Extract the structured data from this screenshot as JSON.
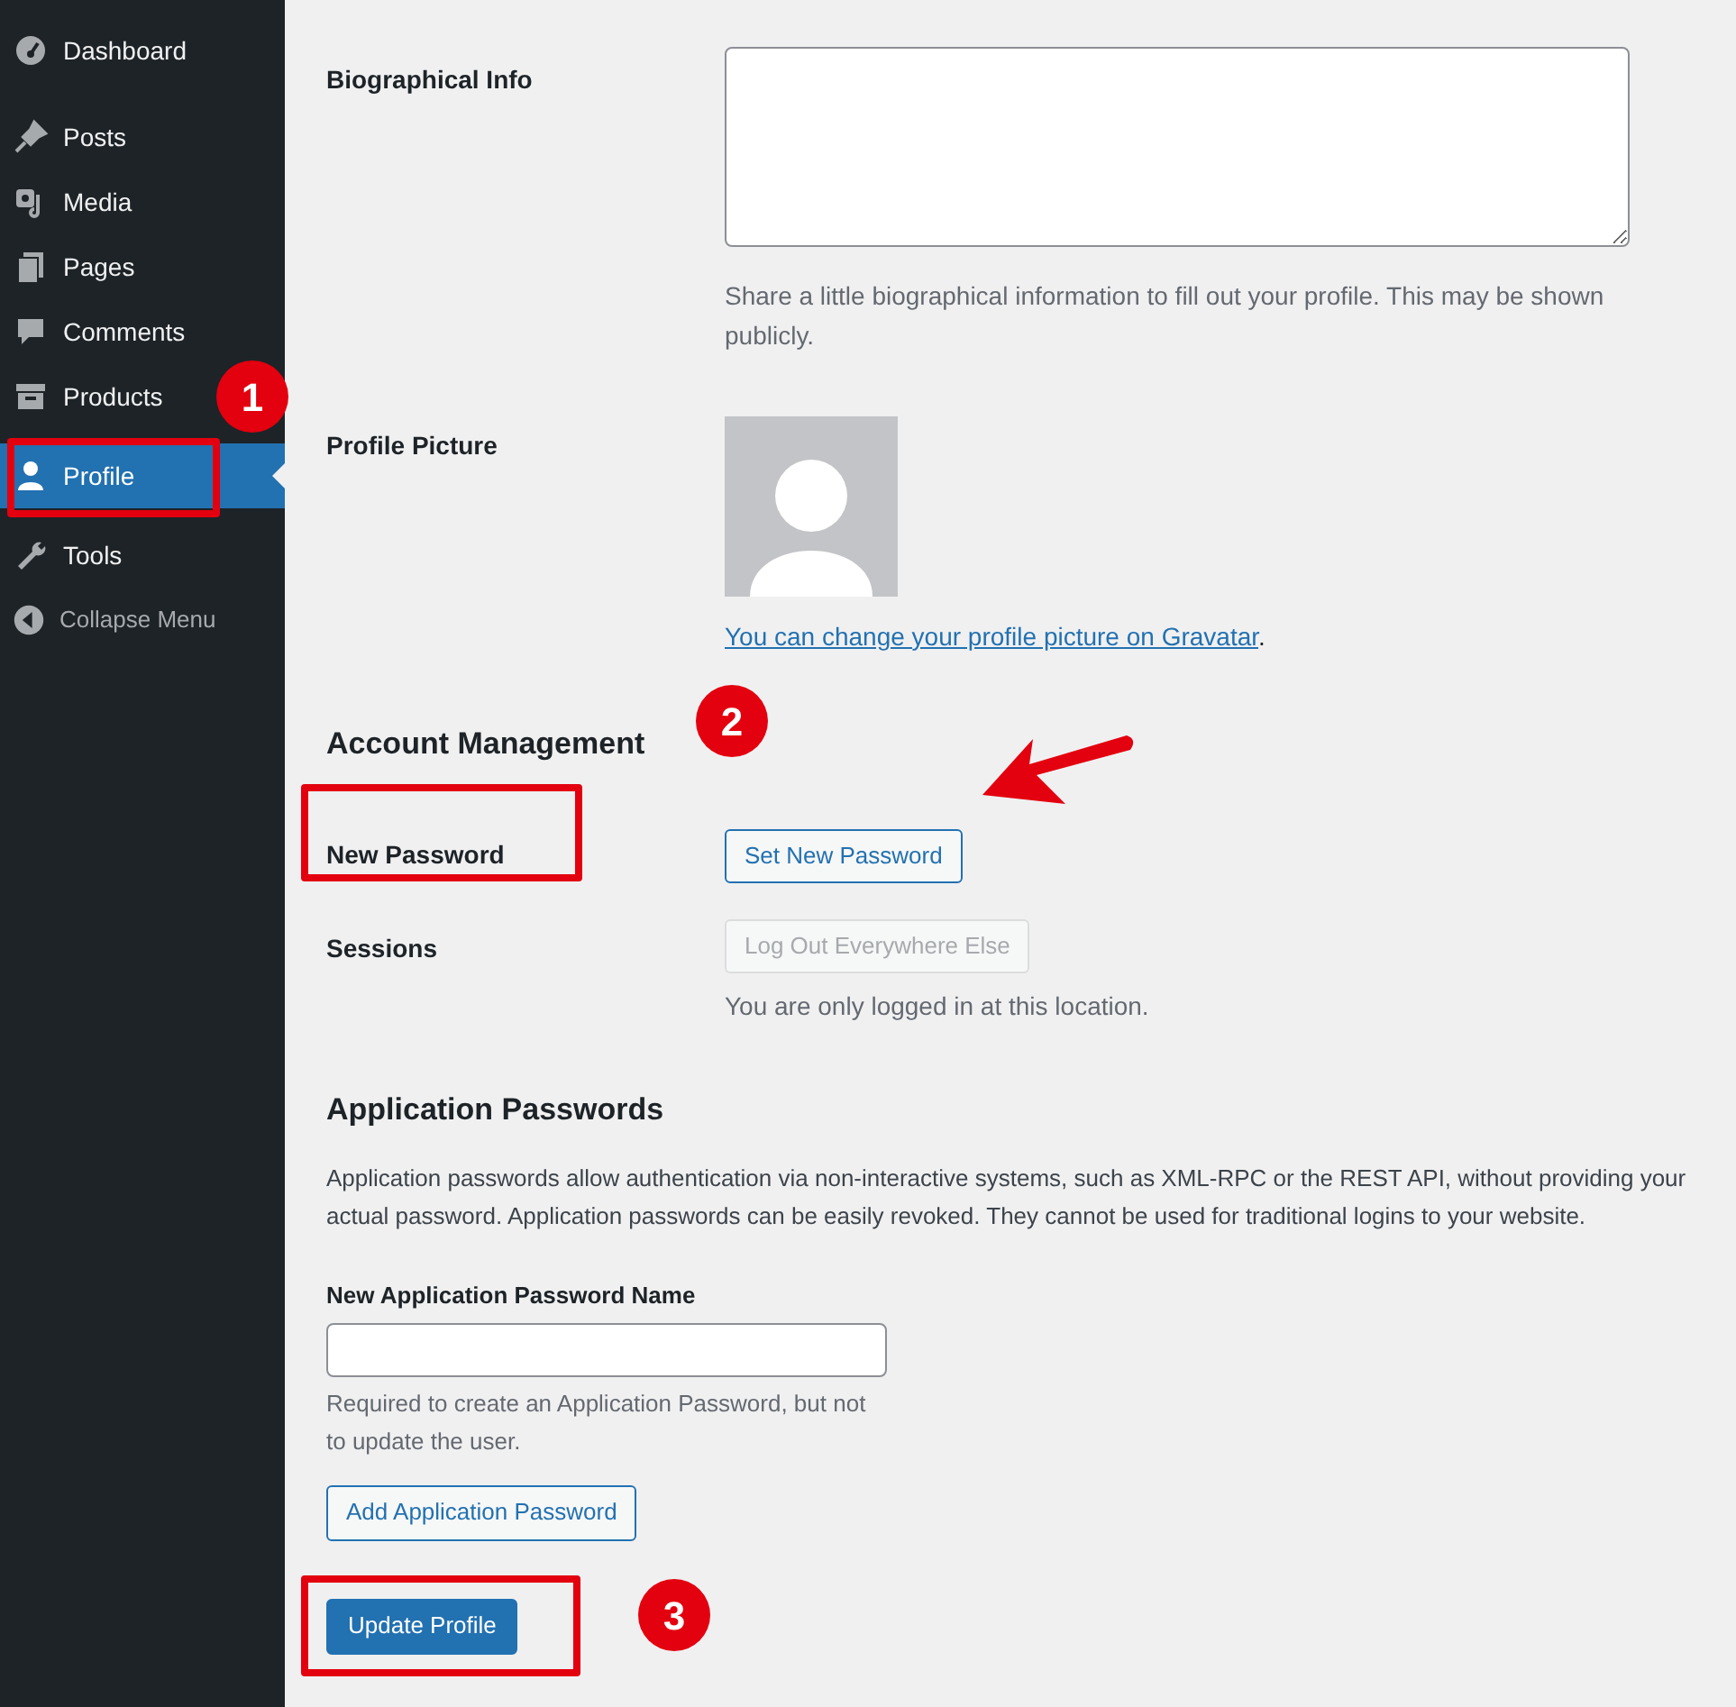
{
  "sidebar": {
    "items": [
      {
        "label": "Dashboard",
        "selected": false
      },
      {
        "label": "Posts",
        "selected": false
      },
      {
        "label": "Media",
        "selected": false
      },
      {
        "label": "Pages",
        "selected": false
      },
      {
        "label": "Comments",
        "selected": false
      },
      {
        "label": "Products",
        "selected": false
      },
      {
        "label": "Profile",
        "selected": true
      },
      {
        "label": "Tools",
        "selected": false
      }
    ],
    "collapse_menu": "Collapse Menu"
  },
  "biographical_info": {
    "label": "Biographical Info",
    "description": "Share a little biographical information to fill out your profile. This may be shown publicly."
  },
  "profile_picture": {
    "label": "Profile Picture",
    "link": "You can change your profile picture on Gravatar",
    "after_link": "."
  },
  "account_management": {
    "heading": "Account Management",
    "new_password": {
      "label": "New Password",
      "button": "Set New Password"
    },
    "sessions": {
      "label": "Sessions",
      "button": "Log Out Everywhere Else",
      "disabled": true,
      "note": "You are only logged in at this location."
    }
  },
  "application_passwords": {
    "heading": "Application Passwords",
    "description": "Application passwords allow authentication via non-interactive systems, such as XML-RPC or the REST API, without providing your actual password. Application passwords can be easily revoked. They cannot be used for traditional logins to your website.",
    "name_label": "New Application Password Name",
    "name_help": "Required to create an Application Password, but not to update the user.",
    "add_button": "Add Application Password"
  },
  "update_button": "Update Profile",
  "annotations": {
    "markers": [
      "1",
      "2",
      "3"
    ]
  }
}
